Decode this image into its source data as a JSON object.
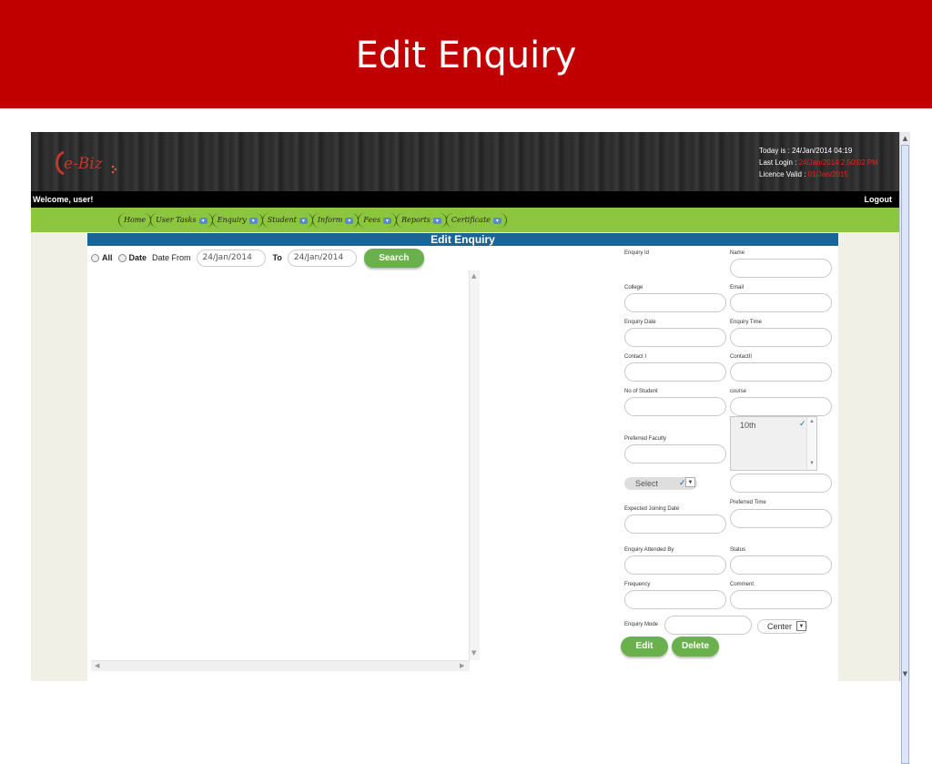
{
  "slide": {
    "title": "Edit Enquiry",
    "accent": "#c00000"
  },
  "header": {
    "logo_text": "e-Biz",
    "today_label": "Today is : ",
    "today_value": "24/Jan/2014 04:19",
    "last_login_label": "Last Login : ",
    "last_login_value": "24/Jan/2014 2:50:02 PM",
    "licence_label": "Licence Valid : ",
    "licence_value": "01/Jan/2015"
  },
  "welcome": {
    "text": "Welcome,  user!",
    "logout": "Logout"
  },
  "nav": {
    "items": [
      {
        "label": "Home",
        "has_caret": false
      },
      {
        "label": "User Tasks",
        "has_caret": true
      },
      {
        "label": "Enquiry",
        "has_caret": true
      },
      {
        "label": "Student",
        "has_caret": true
      },
      {
        "label": "Inform",
        "has_caret": true
      },
      {
        "label": "Fees",
        "has_caret": true
      },
      {
        "label": "Reports",
        "has_caret": true
      },
      {
        "label": "Certificate",
        "has_caret": true
      }
    ]
  },
  "content": {
    "title": "Edit Enquiry",
    "filter": {
      "all_label": "All",
      "date_label": "Date",
      "date_from_label": "Date From",
      "date_from_value": "24/Jan/2014",
      "to_label": "To",
      "to_value": "24/Jan/2014",
      "search_label": "Search"
    }
  },
  "form": {
    "enquiry_id": "Enquiry Id",
    "name": "Name",
    "college": "College",
    "email": "Email",
    "enquiry_date": "Enquiry Date",
    "enquiry_time": "Enquiry Time",
    "contact1": "Contact I",
    "contact2": "ContactII",
    "no_of_student": "No of Student",
    "course": "course",
    "course_option": "10th",
    "preferred_faculty": "Preferred Faculty",
    "select_value": "Select",
    "expected_joining_date": "Expected Joining Date",
    "preferred_time": "Preferred Time",
    "enquiry_attended_by": "Enquiry Attended By",
    "status": "Status",
    "frequency": "Frequency",
    "comment": "Comment",
    "enquiry_mode": "Enquiry Mode",
    "center_value": "Center",
    "edit_label": "Edit",
    "delete_label": "Delete"
  }
}
